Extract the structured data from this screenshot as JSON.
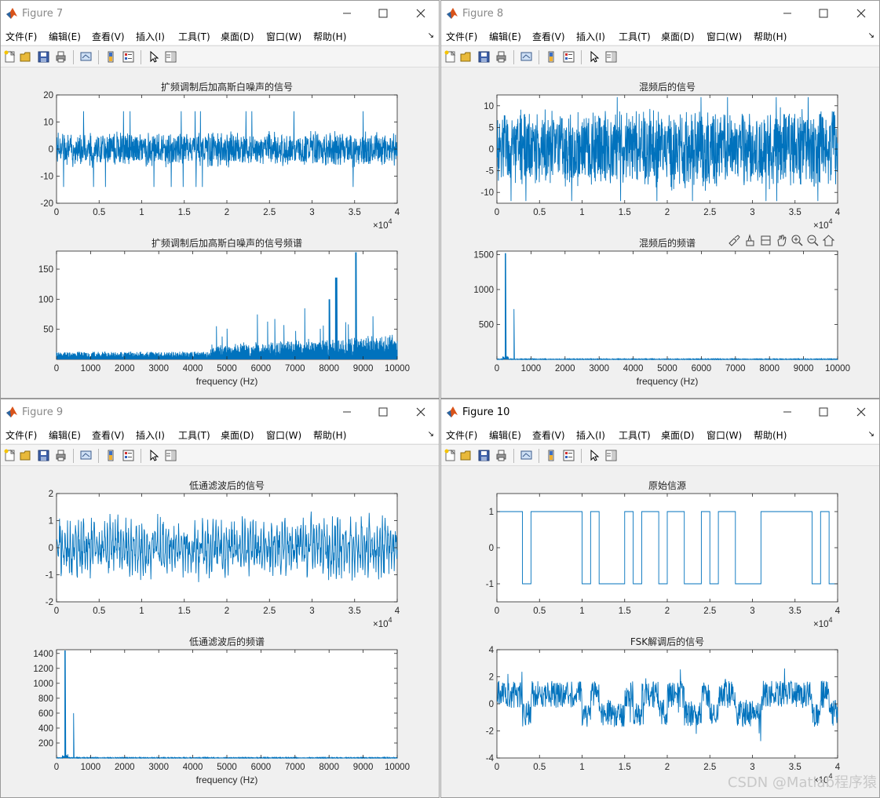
{
  "menu": [
    "文件(F)",
    "编辑(E)",
    "查看(V)",
    "插入(I)",
    "工具(T)",
    "桌面(D)",
    "窗口(W)",
    "帮助(H)"
  ],
  "menu_overflow_glyph": "↘",
  "toolbar_icons": [
    "new-figure-icon",
    "open-file-icon",
    "save-icon",
    "print-icon",
    "link-plot-icon",
    "insert-colorbar-icon",
    "insert-legend-icon",
    "edit-plot-arrow-icon",
    "property-inspector-icon"
  ],
  "axes_toolbar_icons": [
    "brush-icon",
    "data-tips-icon",
    "rotate-icon",
    "pan-icon",
    "zoom-in-icon",
    "zoom-out-icon",
    "home-icon"
  ],
  "colors": {
    "plot_line": "#0072BD",
    "window_bg": "#f0f0f0",
    "axes_bg": "#ffffff"
  },
  "watermark": "CSDN @Matlab程序猿",
  "figures": [
    {
      "id": "fig7",
      "title": "Figure 7",
      "active": false,
      "axes": [
        {
          "title": "扩频调制后加高斯白噪声的信号",
          "kind": "noise",
          "amp": 7,
          "spike": 14,
          "seed": 7,
          "xlim": [
            0,
            40000
          ],
          "ylim": [
            -20,
            20
          ],
          "xticks": [
            "0",
            "0.5",
            "1",
            "1.5",
            "2",
            "2.5",
            "3",
            "3.5",
            "4"
          ],
          "yticks": [
            "20",
            "10",
            "0",
            "-10",
            "-20"
          ],
          "exponent": "×10",
          "exponent_power": "4",
          "xlabel": ""
        },
        {
          "title": "扩频调制后加高斯白噪声的信号频谱",
          "kind": "spectrum_wide",
          "seed": 11,
          "xlim": [
            0,
            10000
          ],
          "ylim": [
            0,
            180
          ],
          "xticks": [
            "0",
            "1000",
            "2000",
            "3000",
            "4000",
            "5000",
            "6000",
            "7000",
            "8000",
            "9000",
            "10000"
          ],
          "yticks": [
            "150",
            "100",
            "50"
          ],
          "xlabel": "frequency (Hz)"
        }
      ]
    },
    {
      "id": "fig8",
      "title": "Figure 8",
      "active": false,
      "axes": [
        {
          "title": "混频后的信号",
          "kind": "noise",
          "amp": 10,
          "spike": 12,
          "seed": 8,
          "xlim": [
            0,
            40000
          ],
          "ylim": [
            -12.5,
            12.5
          ],
          "xticks": [
            "0",
            "0.5",
            "1",
            "1.5",
            "2",
            "2.5",
            "3",
            "3.5",
            "4"
          ],
          "yticks": [
            "10",
            "5",
            "0",
            "-5",
            "-10"
          ],
          "exponent": "×10",
          "exponent_power": "4",
          "xlabel": ""
        },
        {
          "title": "混频后的频谱",
          "kind": "spectrum_peaks",
          "peaks": [
            1520,
            720
          ],
          "seed": 13,
          "xlim": [
            0,
            10000
          ],
          "ylim": [
            0,
            1550
          ],
          "xticks": [
            "0",
            "1000",
            "2000",
            "3000",
            "4000",
            "5000",
            "6000",
            "7000",
            "8000",
            "9000",
            "10000"
          ],
          "yticks": [
            "1500",
            "1000",
            "500"
          ],
          "xlabel": "frequency (Hz)",
          "has_axes_toolbar": true
        }
      ]
    },
    {
      "id": "fig9",
      "title": "Figure 9",
      "active": false,
      "axes": [
        {
          "title": "低通滤波后的信号",
          "kind": "lowpass",
          "amp": 1.0,
          "seed": 9,
          "xlim": [
            0,
            40000
          ],
          "ylim": [
            -2,
            2
          ],
          "xticks": [
            "0",
            "0.5",
            "1",
            "1.5",
            "2",
            "2.5",
            "3",
            "3.5",
            "4"
          ],
          "yticks": [
            "2",
            "1",
            "0",
            "-1",
            "-2"
          ],
          "exponent": "×10",
          "exponent_power": "4",
          "xlabel": ""
        },
        {
          "title": "低通滤波后的频谱",
          "kind": "spectrum_peaks",
          "peaks": [
            1440,
            600
          ],
          "seed": 17,
          "xlim": [
            0,
            10000
          ],
          "ylim": [
            0,
            1450
          ],
          "xticks": [
            "0",
            "1000",
            "2000",
            "3000",
            "4000",
            "5000",
            "6000",
            "7000",
            "8000",
            "9000",
            "10000"
          ],
          "yticks": [
            "1400",
            "1200",
            "1000",
            "800",
            "600",
            "400",
            "200"
          ],
          "xlabel": "frequency (Hz)"
        }
      ]
    },
    {
      "id": "fig10",
      "title": "Figure 10",
      "active": true,
      "axes": [
        {
          "title": "原始信源",
          "kind": "square",
          "bits": [
            1,
            1,
            1,
            -1,
            1,
            1,
            1,
            1,
            1,
            1,
            -1,
            1,
            -1,
            -1,
            -1,
            1,
            -1,
            1,
            1,
            -1,
            1,
            1,
            -1,
            -1,
            1,
            -1,
            1,
            1,
            -1,
            -1,
            -1,
            1,
            1,
            1,
            1,
            1,
            1,
            -1,
            1,
            -1
          ],
          "xlim": [
            0,
            40000
          ],
          "ylim": [
            -1.5,
            1.5
          ],
          "xticks": [
            "0",
            "0.5",
            "1",
            "1.5",
            "2",
            "2.5",
            "3",
            "3.5",
            "4"
          ],
          "yticks": [
            "1",
            "0",
            "-1"
          ],
          "exponent": "×10",
          "exponent_power": "4",
          "xlabel": ""
        },
        {
          "title": "FSK解调后的信号",
          "kind": "demod",
          "seed": 21,
          "xlim": [
            0,
            40000
          ],
          "ylim": [
            -4,
            4
          ],
          "xticks": [
            "0",
            "0.5",
            "1",
            "1.5",
            "2",
            "2.5",
            "3",
            "3.5",
            "4"
          ],
          "yticks": [
            "4",
            "2",
            "0",
            "-2",
            "-4"
          ],
          "exponent": "×10",
          "exponent_power": "4",
          "xlabel": ""
        }
      ]
    }
  ]
}
